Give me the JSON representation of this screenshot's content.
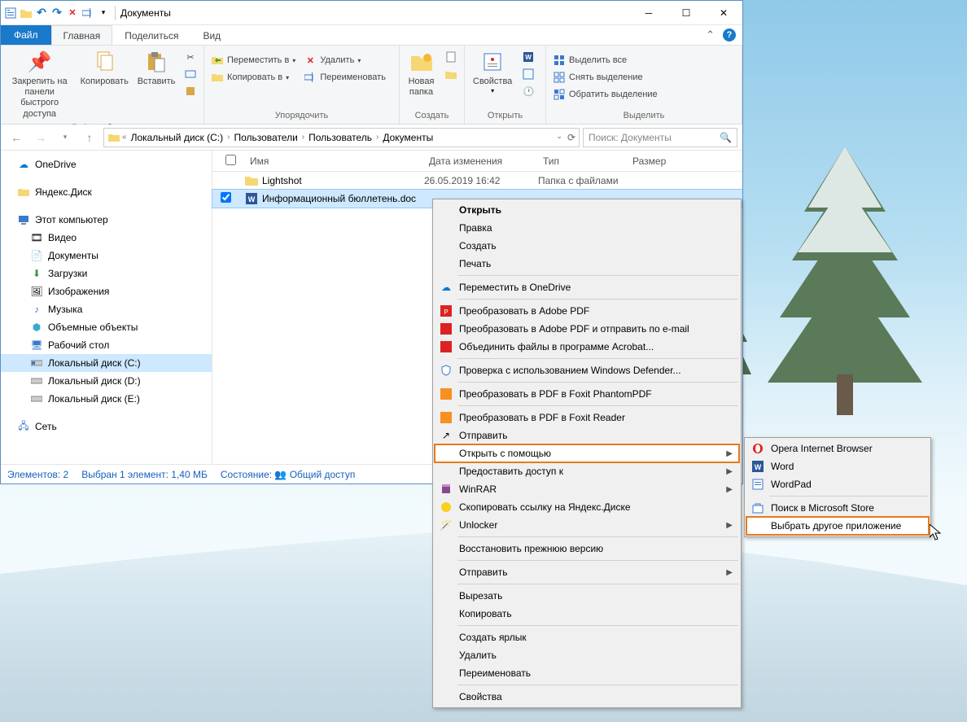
{
  "window": {
    "title": "Документы"
  },
  "tabs": {
    "file": "Файл",
    "home": "Главная",
    "share": "Поделиться",
    "view": "Вид"
  },
  "ribbon": {
    "clipboard": {
      "pin": "Закрепить на панели быстрого доступа",
      "copy": "Копировать",
      "paste": "Вставить",
      "group": "Буфер обмена"
    },
    "organize": {
      "move": "Переместить в",
      "copyto": "Копировать в",
      "del": "Удалить",
      "rename": "Переименовать",
      "group": "Упорядочить"
    },
    "new": {
      "folder": "Новая папка",
      "group": "Создать"
    },
    "open": {
      "props": "Свойства",
      "group": "Открыть"
    },
    "select": {
      "all": "Выделить все",
      "none": "Снять выделение",
      "invert": "Обратить выделение",
      "group": "Выделить"
    }
  },
  "breadcrumb": {
    "a": "Локальный диск (C:)",
    "b": "Пользователи",
    "c": "Пользователь",
    "d": "Документы"
  },
  "search": {
    "placeholder": "Поиск: Документы"
  },
  "nav": {
    "onedrive": "OneDrive",
    "yadisk": "Яндекс.Диск",
    "thispc": "Этот компьютер",
    "video": "Видео",
    "docs": "Документы",
    "downloads": "Загрузки",
    "images": "Изображения",
    "music": "Музыка",
    "objects3d": "Объемные объекты",
    "desktop": "Рабочий стол",
    "diskC": "Локальный диск (C:)",
    "diskD": "Локальный диск (D:)",
    "diskE": "Локальный диск (E:)",
    "network": "Сеть"
  },
  "cols": {
    "name": "Имя",
    "date": "Дата изменения",
    "type": "Тип",
    "size": "Размер"
  },
  "rows": {
    "r0": {
      "name": "Lightshot",
      "date": "26.05.2019 16:42",
      "type": "Папка с файлами"
    },
    "r1": {
      "name": "Информационный бюллетень.doc"
    }
  },
  "status": {
    "count": "Элементов: 2",
    "sel": "Выбран 1 элемент: 1,40 МБ",
    "state_label": "Состояние:",
    "state": "Общий доступ"
  },
  "ctx": {
    "open": "Открыть",
    "edit": "Правка",
    "create": "Создать",
    "print": "Печать",
    "onedrive": "Переместить в OneDrive",
    "pdf1": "Преобразовать в Adobe PDF",
    "pdf2": "Преобразовать в Adobe PDF и отправить по e-mail",
    "acrobat": "Объединить файлы в программе Acrobat...",
    "defender": "Проверка с использованием Windows Defender...",
    "foxit1": "Преобразовать в PDF в Foxit PhantomPDF",
    "foxit2": "Преобразовать в PDF в Foxit Reader",
    "send": "Отправить",
    "openwith": "Открыть с помощью",
    "share": "Предоставить доступ к",
    "winrar": "WinRAR",
    "yadisk": "Скопировать ссылку на Яндекс.Диске",
    "unlocker": "Unlocker",
    "restore": "Восстановить прежнюю версию",
    "send2": "Отправить",
    "cut": "Вырезать",
    "copy": "Копировать",
    "shortcut": "Создать ярлык",
    "delete": "Удалить",
    "rename": "Переименовать",
    "props": "Свойства"
  },
  "sub": {
    "opera": "Opera Internet Browser",
    "word": "Word",
    "wordpad": "WordPad",
    "store": "Поиск в Microsoft Store",
    "choose": "Выбрать другое приложение"
  }
}
